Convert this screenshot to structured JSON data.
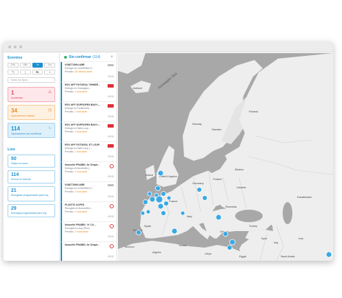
{
  "left": {
    "events_title": "Eventos",
    "tabs": [
      {
        "label": "24h",
        "active": false
      },
      {
        "label": "48h",
        "active": false
      },
      {
        "label": "7d",
        "active": true
      },
      {
        "label": "1m",
        "active": false
      }
    ],
    "filter_icons": [
      "temperature-icon",
      "door-icon",
      "truck-icon",
      "location-icon"
    ],
    "type_select": "Todos los tipos",
    "cards": [
      {
        "num": "1",
        "label": "Incidentes",
        "style": "red",
        "icon": "⚠"
      },
      {
        "num": "34",
        "label": "Operaciones tardías",
        "style": "orange",
        "icon": "◷"
      },
      {
        "num": "114",
        "label": "Operaciones sin confirmar",
        "style": "blue",
        "icon": "♘"
      }
    ],
    "live_title": "Live",
    "live": [
      {
        "num": "50",
        "label": "Viajes en curso"
      },
      {
        "num": "114",
        "label": "Envíos en tránsito"
      },
      {
        "num": "21",
        "label": "Recogidas programadas para hoy"
      },
      {
        "num": "29",
        "label": "Entregas programadas para hoy"
      }
    ]
  },
  "middle": {
    "title": "Sin confirmar",
    "count": "(114)",
    "close": "×",
    "items": [
      {
        "title": "0158773904 ABR",
        "sub": "Entrega en LA MARINA (T...",
        "prev_prefix": "Previsto:",
        "prev": "28 minutos tarde",
        "time": "08:50",
        "logo": "grey"
      },
      {
        "title": "ROV AFF FUTUROL THINER...",
        "sub": "Entrega en Champigne...",
        "prev_prefix": "Previsto:",
        "prev": "1 hora tarde",
        "time": "08:50",
        "logo": "red"
      },
      {
        "title": "ROV AFF SOPROFEN BAVY-...",
        "sub": "Entrega en Fredericshe...",
        "prev_prefix": "Previsto:",
        "prev": "1 hora tarde",
        "time": "08:50",
        "logo": "red"
      },
      {
        "title": "ROV AFF SOPROFEN BAVY-...",
        "sub": "Entrega en Saint-Loup-...",
        "prev_prefix": "Previsto:",
        "prev": "1 hora tarde",
        "time": "08:50",
        "logo": "red"
      },
      {
        "title": "ROV AFF FUTUROL ST LOUP...",
        "sub": "Entrega en Saint-Loup (...",
        "prev_prefix": "Previsto:",
        "prev": "1 hora tarde",
        "time": "08:50",
        "logo": "red"
      },
      {
        "title": "Nouvelle PRABEL Ile Chape...",
        "sub": "Entrega en Bonneville (...",
        "prev_prefix": "Previsto:",
        "prev": "1 hora tarde",
        "time": "08:50",
        "logo": "alt"
      },
      {
        "title": "0158773903 ABR",
        "sub": "Entrega en LA MARINA (T...",
        "prev_prefix": "Previsto:",
        "prev": "1 hora tarde",
        "time": "08:50",
        "logo": "grey"
      },
      {
        "title": "PLASTIC ALPES",
        "sub": "Recogida en Bonneville (...",
        "prev_prefix": "Previsto:",
        "prev": "1 hora tarde",
        "time": "08:50",
        "logo": "alt"
      },
      {
        "title": "Nouvelle PRABEL 'tr' Ch...",
        "sub": "Recogida en Aup (Pers)",
        "prev_prefix": "Previsto:",
        "prev": "2 horas tarde",
        "time": "08:50",
        "logo": "alt"
      },
      {
        "title": "Nouvelle PRABEL Ile Chape...",
        "sub": "",
        "prev_prefix": "",
        "prev": "",
        "time": "08:50",
        "logo": "alt"
      }
    ]
  },
  "map": {
    "sea_label": "Norwegian Sea",
    "countries": [
      "Iceland",
      "Sweden",
      "Finland",
      "Norway",
      "United Kingdom",
      "Ireland",
      "Germany",
      "Poland",
      "Ukraine",
      "France",
      "Spain",
      "Portugal",
      "Italy",
      "Romania",
      "Turkey",
      "Greece",
      "Algeria",
      "Libya",
      "Egypt",
      "Morocco",
      "Belarus",
      "Kazakhstan",
      "Syria",
      "Iraq",
      "Iran",
      "Saudi Arabia",
      "Tunisia"
    ]
  }
}
